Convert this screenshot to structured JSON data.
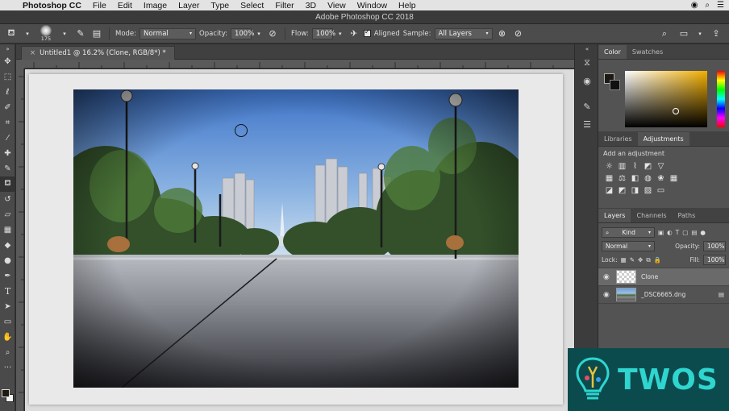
{
  "menubar": {
    "app_name": "Photoshop CC",
    "items": [
      "File",
      "Edit",
      "Image",
      "Layer",
      "Type",
      "Select",
      "Filter",
      "3D",
      "View",
      "Window",
      "Help"
    ]
  },
  "window": {
    "title": "Adobe Photoshop CC 2018"
  },
  "options": {
    "brush_size": "175",
    "mode_label": "Mode:",
    "mode_value": "Normal",
    "opacity_label": "Opacity:",
    "opacity_value": "100%",
    "flow_label": "Flow:",
    "flow_value": "100%",
    "aligned_label": "Aligned",
    "sample_label": "Sample:",
    "sample_value": "All Layers"
  },
  "document": {
    "tab_title": "Untitled1 @ 16.2% (Clone, RGB/8*) *",
    "close_glyph": "×"
  },
  "panels": {
    "color_tabs": [
      "Color",
      "Swatches"
    ],
    "library_tabs": [
      "Libraries",
      "Adjustments"
    ],
    "adjustments_title": "Add an adjustment",
    "layer_tabs": [
      "Layers",
      "Channels",
      "Paths"
    ],
    "kind_label": "Kind",
    "blend_mode": "Normal",
    "opacity_label": "Opacity:",
    "opacity_value": "100%",
    "lock_label": "Lock:",
    "fill_label": "Fill:",
    "fill_value": "100%",
    "layers": [
      {
        "name": "Clone"
      },
      {
        "name": "_DSC6665.dng"
      }
    ]
  },
  "watermark": {
    "text": "TWOS"
  },
  "colors": {
    "foreground": "#1c1a12",
    "picker_hue": "#f2ae00",
    "watermark_bg": "#0c4b4d",
    "watermark_text": "#2fd5cf"
  }
}
